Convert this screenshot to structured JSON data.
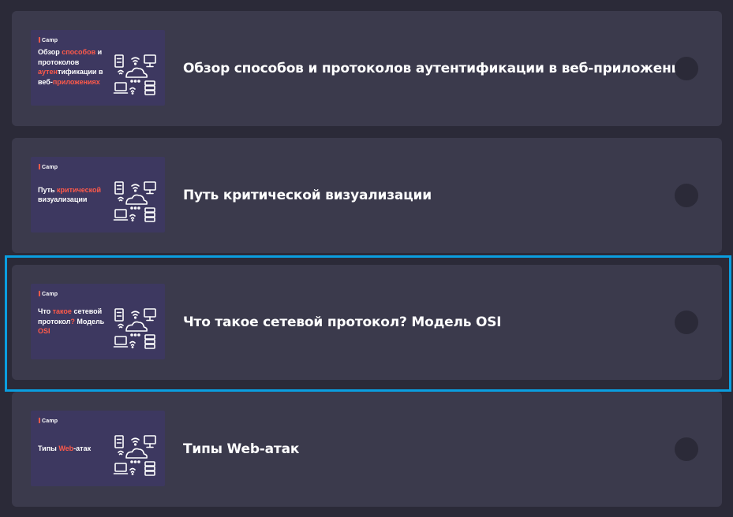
{
  "lessons": [
    {
      "brand": "Camp",
      "thumb_parts": [
        {
          "text": "Обзор ",
          "hl": false
        },
        {
          "text": "способов",
          "hl": true
        },
        {
          "text": " и протоколов ",
          "hl": false
        },
        {
          "text": "аутен",
          "hl": true
        },
        {
          "text": "тификации в веб-",
          "hl": false
        },
        {
          "text": "приложениях",
          "hl": true
        }
      ],
      "title": "Обзор способов и протоколов аутентификации в веб-приложениях"
    },
    {
      "brand": "Camp",
      "thumb_parts": [
        {
          "text": "Путь ",
          "hl": false
        },
        {
          "text": "критической",
          "hl": true
        },
        {
          "text": " визуализации",
          "hl": false
        }
      ],
      "title": "Путь критической визуализации"
    },
    {
      "brand": "Camp",
      "thumb_parts": [
        {
          "text": "Что ",
          "hl": false
        },
        {
          "text": "такое",
          "hl": true
        },
        {
          "text": " сетевой протокол",
          "hl": false
        },
        {
          "text": "?",
          "hl": true
        },
        {
          "text": " Модель ",
          "hl": false
        },
        {
          "text": "OSI",
          "hl": true
        }
      ],
      "title": "Что такое сетевой протокол? Модель OSI"
    },
    {
      "brand": "Camp",
      "thumb_parts": [
        {
          "text": "Типы ",
          "hl": false
        },
        {
          "text": "Web",
          "hl": true
        },
        {
          "text": "-атак",
          "hl": false
        }
      ],
      "title": "Типы Web-атак"
    }
  ],
  "selected_index": 2,
  "icons": {
    "thumbnail": "network-devices-cloud-icon",
    "status": "status-circle-icon"
  },
  "colors": {
    "background": "#2b2a38",
    "card": "#3b3a4c",
    "thumbnail": "#3d3860",
    "accent": "#ff5a4a",
    "selection": "#0a9ee0"
  }
}
